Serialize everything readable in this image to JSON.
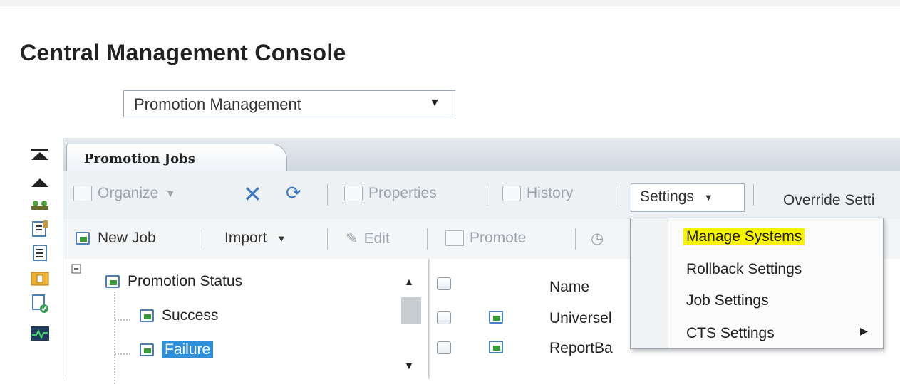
{
  "app": {
    "title": "Central Management Console"
  },
  "selector": {
    "value": "Promotion Management"
  },
  "tabs": [
    {
      "label": "Promotion Jobs"
    }
  ],
  "toolbar1": {
    "organize": "Organize",
    "properties": "Properties",
    "history": "History",
    "settings": "Settings",
    "override": "Override Setti"
  },
  "toolbar2": {
    "new_job": "New Job",
    "import": "Import",
    "edit": "Edit",
    "promote": "Promote"
  },
  "tree": {
    "root": "Promotion Status",
    "children": [
      {
        "label": "Success"
      },
      {
        "label": "Failure",
        "selected": true
      }
    ]
  },
  "grid": {
    "header": "Name",
    "rows": [
      {
        "name": "Universel"
      },
      {
        "name": "ReportBa"
      }
    ]
  },
  "settings_menu": {
    "items": [
      {
        "label": "Manage Systems",
        "highlighted": true
      },
      {
        "label": "Rollback Settings"
      },
      {
        "label": "Job Settings"
      },
      {
        "label": "CTS Settings",
        "submenu": true
      }
    ]
  },
  "colors": {
    "highlight": "#f7f200",
    "selection": "#2f8fd8",
    "panel": "#dde3ea"
  }
}
